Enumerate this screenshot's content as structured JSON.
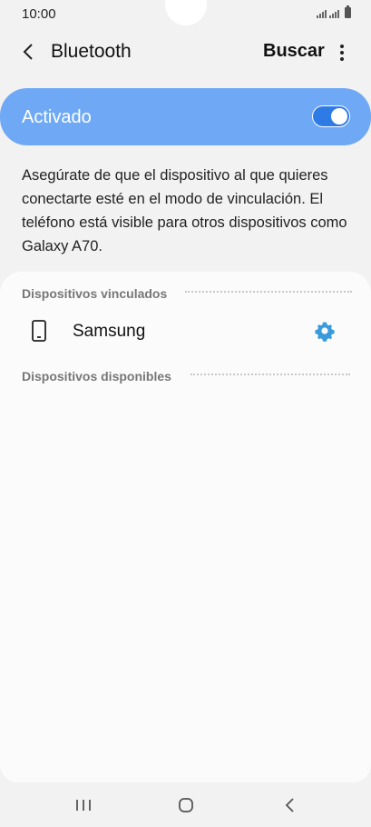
{
  "status_bar": {
    "time": "10:00",
    "icons": [
      "signal-icon",
      "signal-icon",
      "battery-icon"
    ]
  },
  "header": {
    "title": "Bluetooth",
    "search_label": "Buscar",
    "back_icon": "back-arrow-icon",
    "more_icon": "more-vertical-icon"
  },
  "bluetooth_toggle": {
    "label": "Activado",
    "state": "on",
    "accent_color": "#6fa9f5"
  },
  "description": "Asegúrate de que el dispositivo al que quieres conectarte esté en el modo de vinculación. El teléfono está visible para otros dispositivos como Galaxy A70.",
  "paired_section": {
    "header": "Dispositivos vinculados",
    "devices": [
      {
        "name": "Samsung",
        "icon": "phone-icon",
        "action_icon": "settings-icon"
      }
    ]
  },
  "available_section": {
    "header": "Dispositivos disponibles"
  },
  "nav_bar": {
    "buttons": [
      "recents-icon",
      "home-icon",
      "back-icon"
    ]
  }
}
